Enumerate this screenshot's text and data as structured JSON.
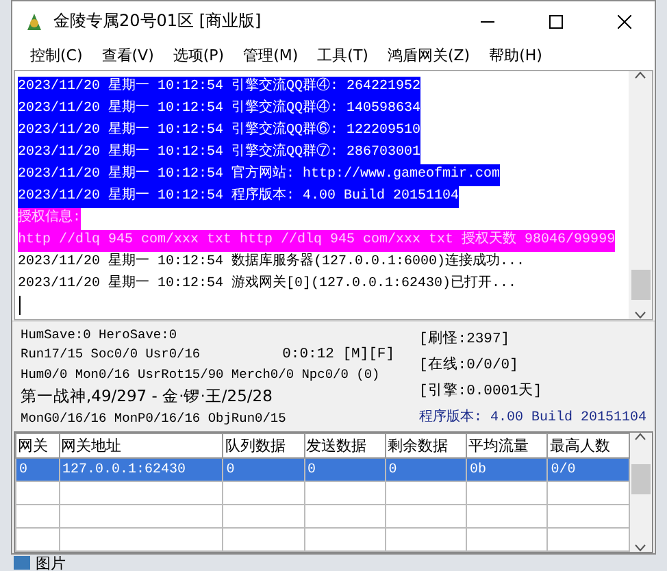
{
  "window": {
    "title": "金陵专属20号01区 [商业版]"
  },
  "menu": [
    "控制(C)",
    "查看(V)",
    "选项(P)",
    "管理(M)",
    "工具(T)",
    "鸿盾网关(Z)",
    "帮助(H)"
  ],
  "log": [
    {
      "kind": "selected",
      "text": "2023/11/20 星期一 10:12:54 引擎交流QQ群④: 264221952"
    },
    {
      "kind": "selected",
      "text": "2023/11/20 星期一 10:12:54 引擎交流QQ群④: 140598634"
    },
    {
      "kind": "selected",
      "text": "2023/11/20 星期一 10:12:54 引擎交流QQ群⑥: 122209510"
    },
    {
      "kind": "selected",
      "text": "2023/11/20 星期一 10:12:54 引擎交流QQ群⑦: 286703001"
    },
    {
      "kind": "selected",
      "text": "2023/11/20 星期一 10:12:54 官方网站: http://www.gameofmir.com"
    },
    {
      "kind": "selected",
      "text": "2023/11/20 星期一 10:12:54 程序版本: 4.00 Build 20151104"
    },
    {
      "kind": "license",
      "text": "授权信息:"
    },
    {
      "kind": "license",
      "text": "http //dlq 945 com/xxx txt http //dlq 945 com/xxx txt 授权天数 98046/99999"
    },
    {
      "kind": "normal",
      "text": "2023/11/20 星期一 10:12:54 数据库服务器(127.0.0.1:6000)连接成功..."
    },
    {
      "kind": "normal",
      "text": "2023/11/20 星期一 10:12:54 游戏网关[0](127.0.0.1:62430)已打开..."
    }
  ],
  "status": {
    "lines": [
      "HumSave:0 HeroSave:0",
      "Run17/15 Soc0/0 Usr0/16",
      "Hum0/0 Mon0/16 UsrRot15/90 Merch0/0 Npc0/0 (0)",
      "第一战神,49/297 - 金·锣·王/25/28",
      "MonG0/16/16 MonP0/16/16 ObjRun0/15"
    ],
    "timer": "0:0:12 [M][F]",
    "counters": [
      "[刷怪:2397]",
      "[在线:0/0/0]",
      "[引擎:0.0001天]"
    ],
    "version": "程序版本: 4.00 Build 20151104"
  },
  "table": {
    "columns": [
      "网关",
      "网关地址",
      "队列数据",
      "发送数据",
      "剩余数据",
      "平均流量",
      "最高人数"
    ],
    "rows": [
      {
        "selected": true,
        "cells": [
          "0",
          "127.0.0.1:62430",
          "0",
          "0",
          "0",
          "0b",
          "0/0"
        ]
      }
    ]
  },
  "taskbar": {
    "label": "图片"
  }
}
